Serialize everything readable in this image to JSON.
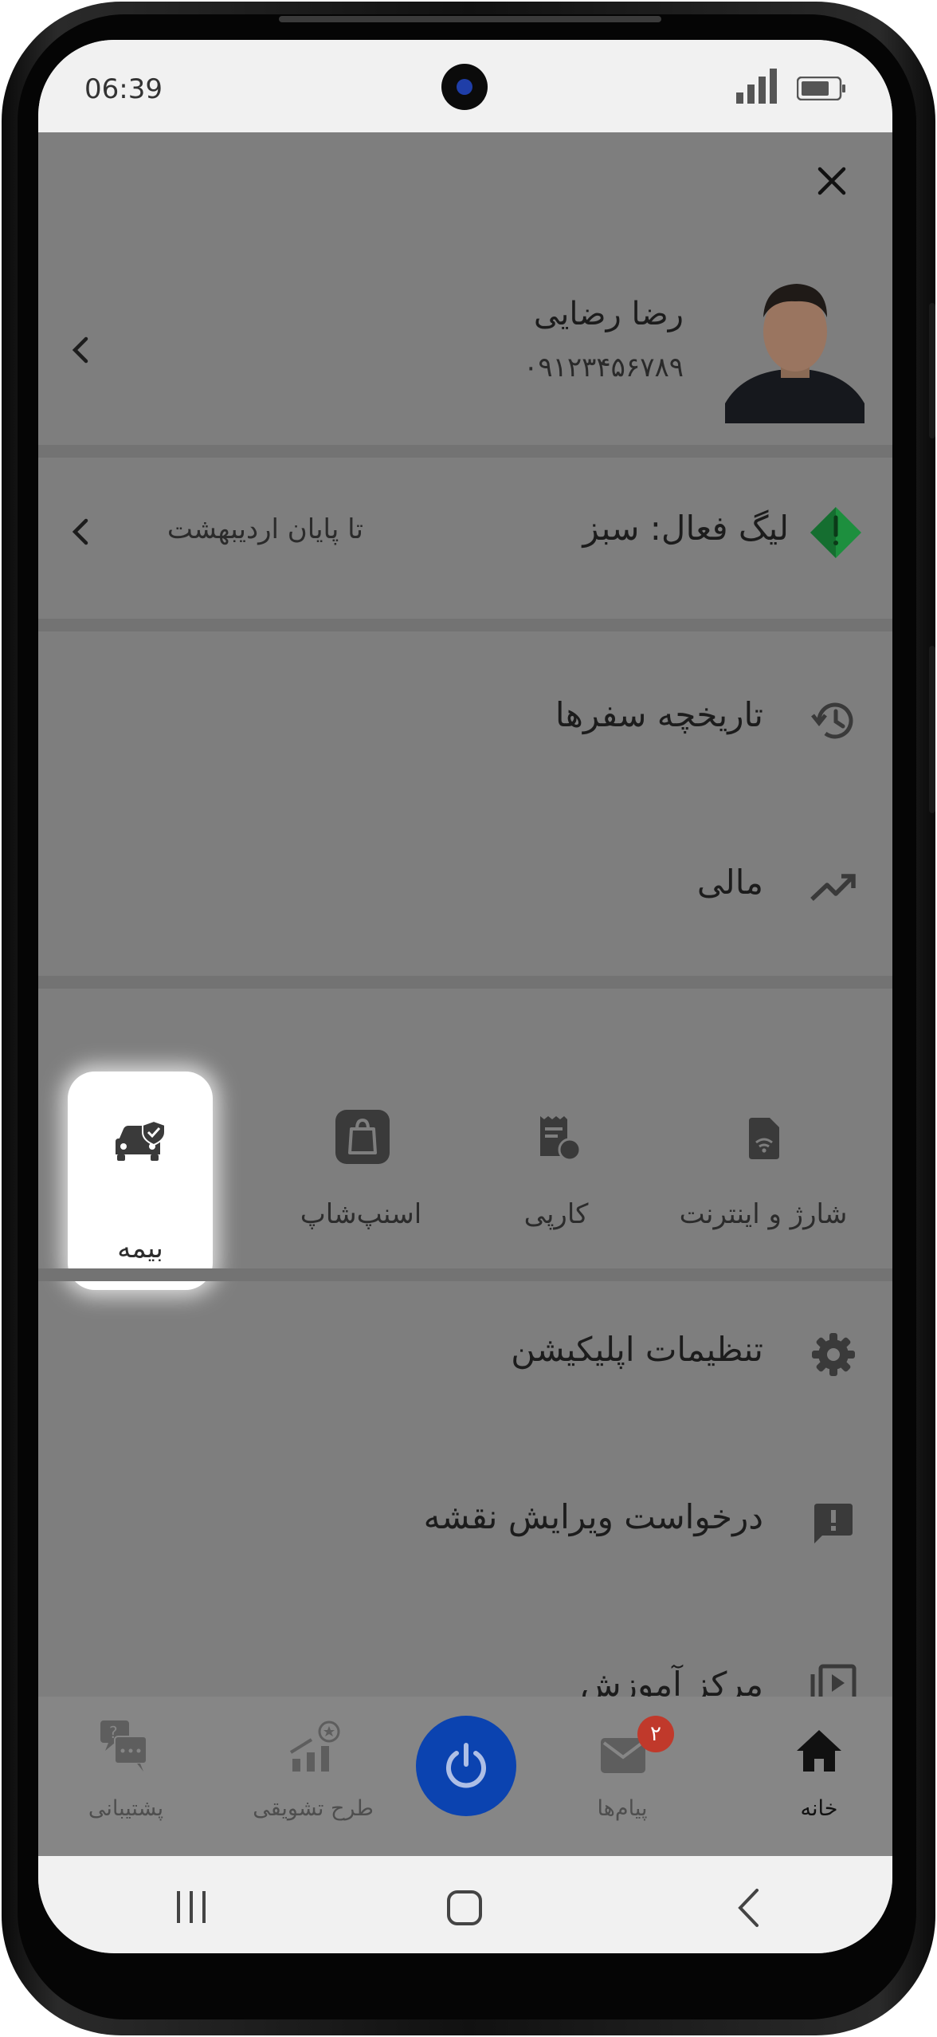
{
  "status_bar": {
    "time": "06:39"
  },
  "profile": {
    "name": "رضا رضایی",
    "phone": "۰۹۱۲۳۴۵۶۷۸۹"
  },
  "league": {
    "label": "لیگ فعال: سبز",
    "period": "تا پایان اردیبهشت"
  },
  "menu": {
    "trip_history": "تاریخچه سفرها",
    "finance": "مالی",
    "app_settings": "تنظیمات اپلیکیشن",
    "map_edit_request": "درخواست ویرایش نقشه",
    "training_center": "مرکز آموزش"
  },
  "services": [
    {
      "label": "شارژ و اینترنت",
      "icon": "sim-card-icon"
    },
    {
      "label": "کارپی",
      "icon": "receipt-icon"
    },
    {
      "label": "اسنپ‌شاپ",
      "icon": "shopping-bag-icon"
    },
    {
      "label": "بیمه",
      "icon": "car-insurance-icon"
    }
  ],
  "bottom_nav": {
    "home": "خانه",
    "messages": "پیام‌ها",
    "messages_badge": "۲",
    "incentive": "طرح تشویقی",
    "support": "پشتیبانی"
  },
  "colors": {
    "accent": "#0b43b0",
    "league_green": "#1d8f3e",
    "badge_red": "#c0392b"
  }
}
